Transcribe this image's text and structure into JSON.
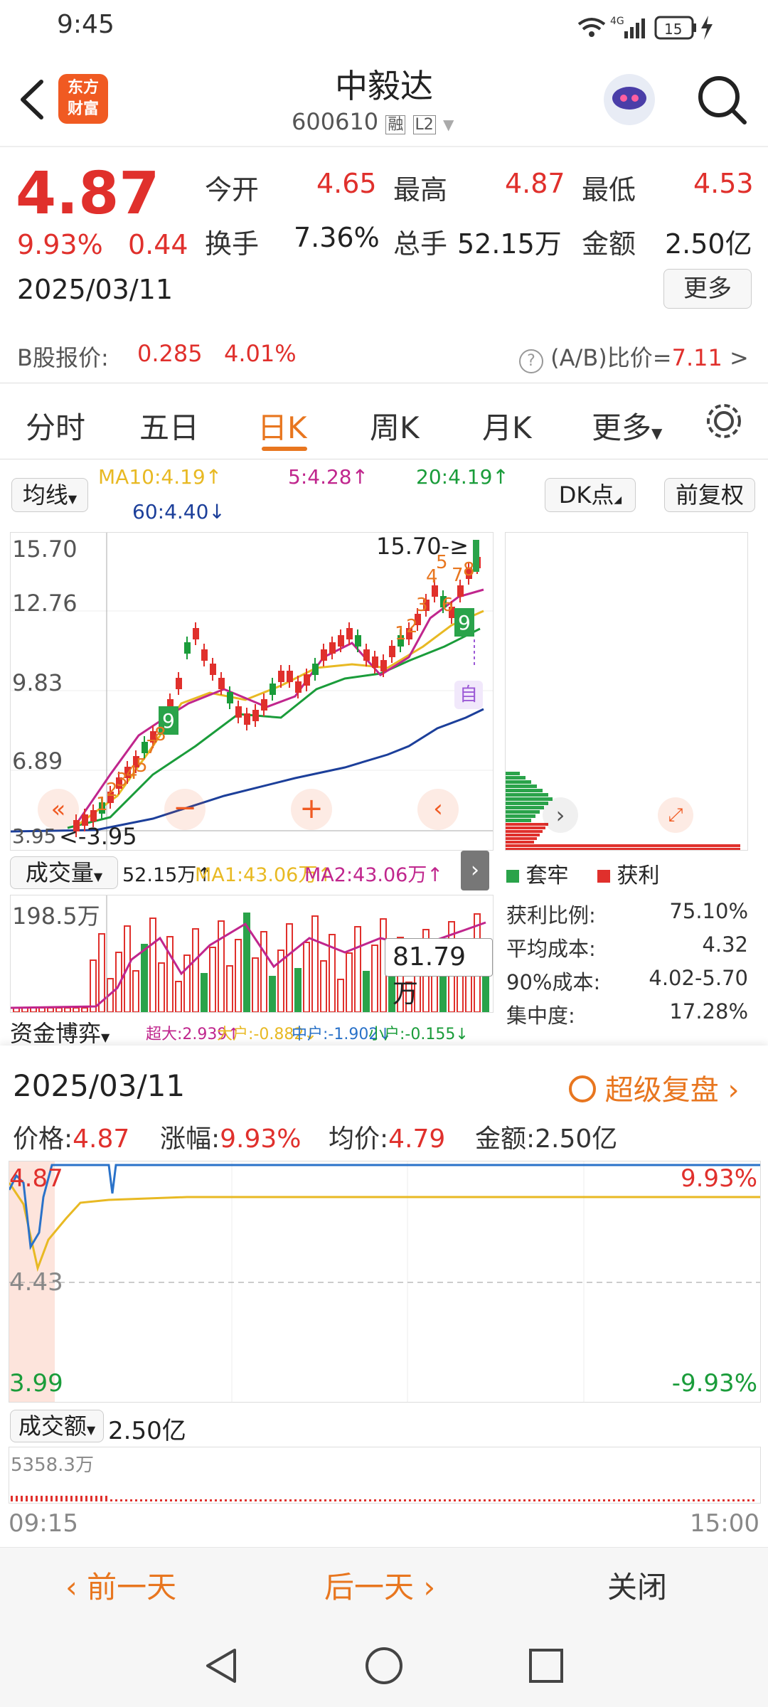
{
  "status": {
    "time": "9:45",
    "battery": "15",
    "network": "4G"
  },
  "header": {
    "brand_line1": "东方",
    "brand_line2": "财富",
    "title": "中毅达",
    "code": "600610",
    "badge_rong": "融",
    "badge_l2": "L2"
  },
  "quote": {
    "price": "4.87",
    "change_pct": "9.93%",
    "change": "0.44",
    "date": "2025/03/11",
    "open_label": "今开",
    "open": "4.65",
    "high_label": "最高",
    "high": "4.87",
    "low_label": "最低",
    "low": "4.53",
    "turnover_label": "换手",
    "turnover": "7.36%",
    "volume_label": "总手",
    "volume": "52.15万",
    "amount_label": "金额",
    "amount": "2.50亿",
    "more_button": "更多"
  },
  "bshare": {
    "label": "B股报价:",
    "price": "0.285",
    "pct": "4.01%",
    "ratio_label": "(A/B)比价=",
    "ratio": "7.11"
  },
  "tabs": [
    "分时",
    "五日",
    "日K",
    "周K",
    "月K",
    "更多"
  ],
  "kline": {
    "ma_selector": "均线",
    "ma10": "MA10:4.19↑",
    "ma5": "5:4.28↑",
    "ma20": "20:4.19↑",
    "ma60": "60:4.40↓",
    "dk_button": "DK点",
    "fq_button": "前复权",
    "y_labels": [
      "15.70",
      "12.76",
      "9.83",
      "6.89",
      "3.95"
    ],
    "max_marker": "15.70-≥",
    "min_marker": "<-3.95",
    "auto_badge": "自"
  },
  "volume_panel": {
    "selector": "成交量",
    "vol": "52.15万↑",
    "ma1": "MA1:43.06万↑",
    "ma2": "MA2:43.06万↑",
    "max_label": "198.5万",
    "tooltip": "81.79万"
  },
  "capital": {
    "selector": "资金博弈",
    "super": "超大:2.939↑",
    "big": "大户:-0.882↓",
    "mid": "中户:-1.902↓",
    "small": "小户:-0.155↓"
  },
  "chips": {
    "legend_trapped": "套牢",
    "legend_profit": "获利",
    "rows": [
      {
        "label": "获利比例:",
        "value": "75.10%"
      },
      {
        "label": "平均成本:",
        "value": "4.32"
      },
      {
        "label": "90%成本:",
        "value": "4.02-5.70"
      },
      {
        "label": "集中度:",
        "value": "17.28%"
      }
    ]
  },
  "replay": {
    "date": "2025/03/11",
    "link": "超级复盘",
    "price_label": "价格:",
    "price": "4.87",
    "pct_label": "涨幅:",
    "pct": "9.93%",
    "avg_label": "均价:",
    "avg": "4.79",
    "amount_label": "金额:",
    "amount": "2.50亿",
    "y_top": "4.87",
    "y_mid": "4.43",
    "y_bottom": "3.99",
    "pct_top": "9.93%",
    "pct_bottom": "-9.93%",
    "amount_selector": "成交额",
    "amount_total": "2.50亿",
    "amount_max": "5358.3万",
    "time_start": "09:15",
    "time_end": "15:00"
  },
  "bottom": {
    "prev": "前一天",
    "next": "后一天",
    "close": "关闭"
  },
  "colors": {
    "red": "#e0302c",
    "green": "#1a9c3a",
    "orange": "#e8761f",
    "brand": "#f05a22"
  }
}
